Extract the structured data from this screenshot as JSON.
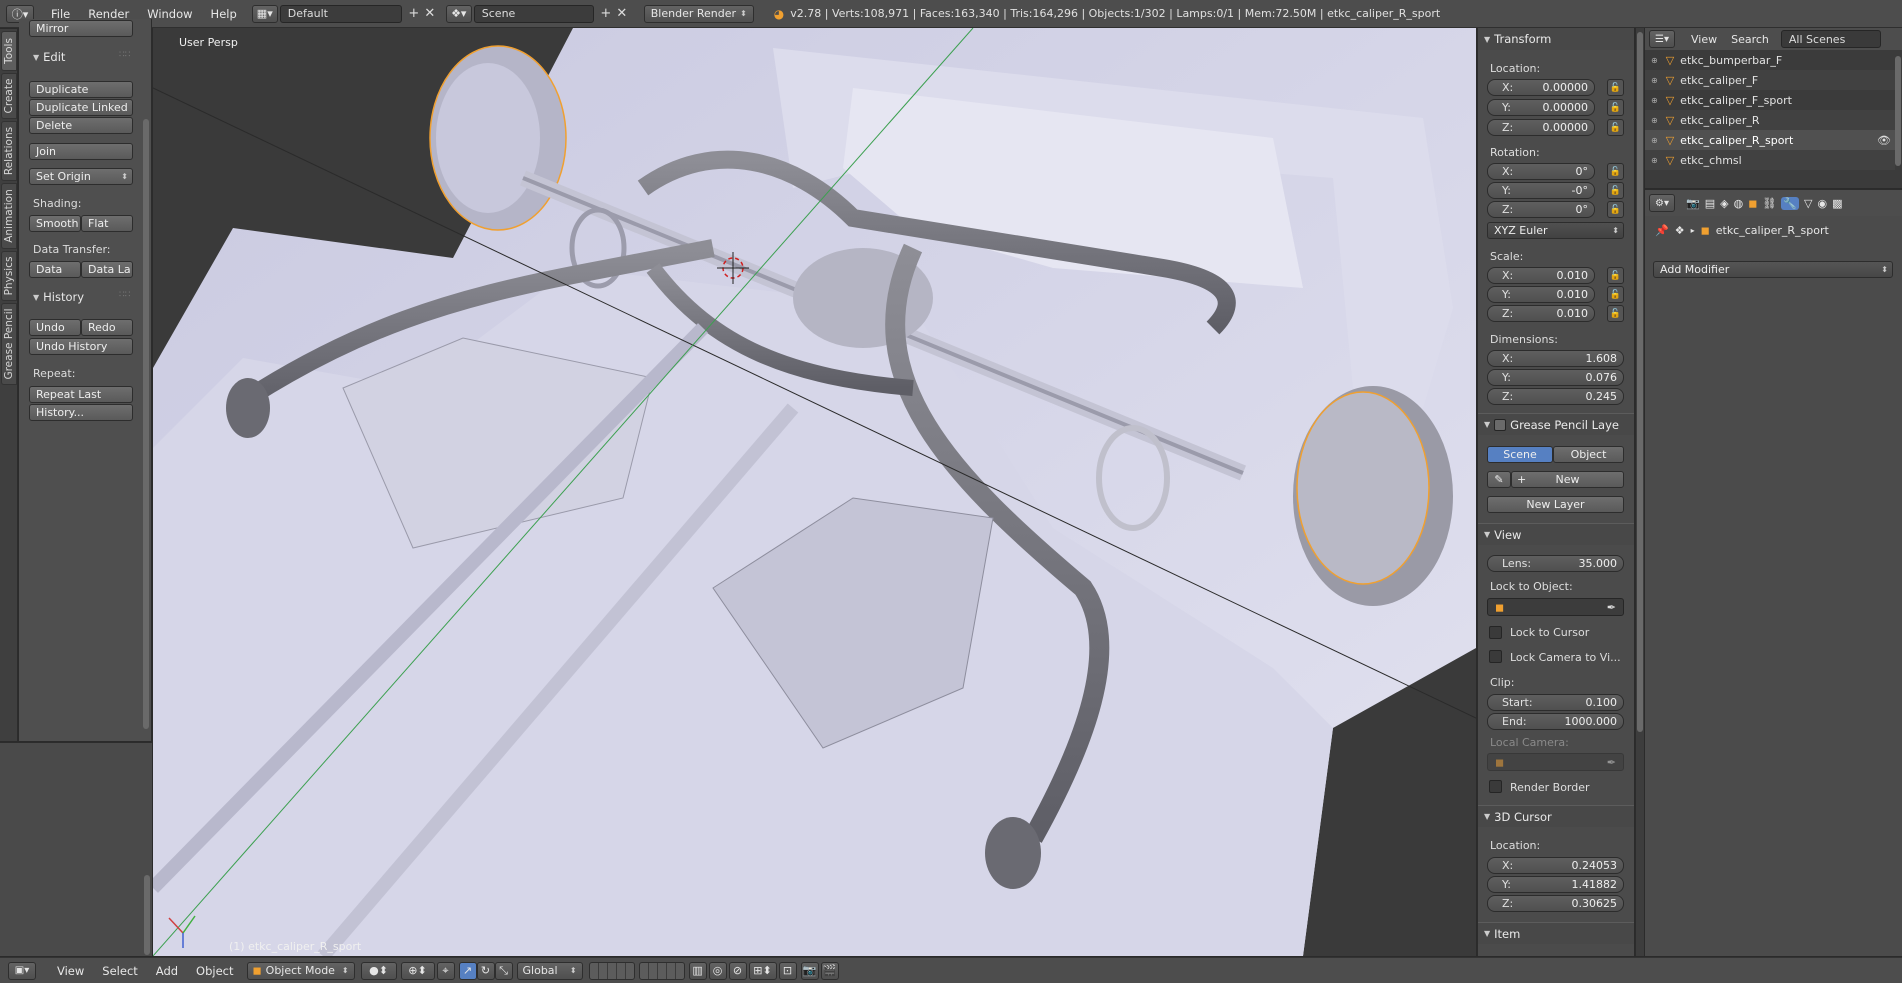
{
  "header": {
    "menus": [
      "File",
      "Render",
      "Window",
      "Help"
    ],
    "layout": "Default",
    "scene": "Scene",
    "engine": "Blender Render",
    "stats": "v2.78 | Verts:108,971 | Faces:163,340 | Tris:164,296 | Objects:1/302 | Lamps:0/1 | Mem:72.50M | etkc_caliper_R_sport"
  },
  "tabs": [
    "Tools",
    "Create",
    "Relations",
    "Animation",
    "Physics",
    "Grease Pencil"
  ],
  "toolshelf": {
    "mirror_button": "Mirror",
    "edit_title": "Edit",
    "duplicate": "Duplicate",
    "duplicate_linked": "Duplicate Linked",
    "delete": "Delete",
    "join": "Join",
    "set_origin": "Set Origin",
    "shading_label": "Shading:",
    "smooth": "Smooth",
    "flat": "Flat",
    "data_transfer_label": "Data Transfer:",
    "data": "Data",
    "data_layout": "Data La",
    "history_title": "History",
    "undo": "Undo",
    "redo": "Redo",
    "undo_history": "Undo History",
    "repeat_label": "Repeat:",
    "repeat_last": "Repeat Last",
    "history_menu": "History..."
  },
  "viewport": {
    "view_name": "User Persp",
    "object_label": "(1) etkc_caliper_R_sport"
  },
  "npanel": {
    "transform_title": "Transform",
    "location_label": "Location:",
    "location": {
      "x": "0.00000",
      "y": "0.00000",
      "z": "0.00000"
    },
    "rotation_label": "Rotation:",
    "rotation": {
      "x": "0°",
      "y": "-0°",
      "z": "0°"
    },
    "rotation_mode": "XYZ Euler",
    "scale_label": "Scale:",
    "scale": {
      "x": "0.010",
      "y": "0.010",
      "z": "0.010"
    },
    "dimensions_label": "Dimensions:",
    "dimensions": {
      "x": "1.608",
      "y": "0.076",
      "z": "0.245"
    },
    "grease_title": "Grease Pencil Laye",
    "gp_scene": "Scene",
    "gp_object": "Object",
    "gp_new": "New",
    "gp_new_layer": "New Layer",
    "view_title": "View",
    "lens_label": "Lens:",
    "lens": "35.000",
    "lock_object_label": "Lock to Object:",
    "lock_cursor": "Lock to Cursor",
    "lock_camera": "Lock Camera to Vi...",
    "clip_label": "Clip:",
    "clip_start_label": "Start:",
    "clip_start": "0.100",
    "clip_end_label": "End:",
    "clip_end": "1000.000",
    "local_camera_label": "Local Camera:",
    "render_border": "Render Border",
    "cursor_title": "3D Cursor",
    "cursor_location_label": "Location:",
    "cursor": {
      "x": "0.24053",
      "y": "1.41882",
      "z": "0.30625"
    },
    "item_title": "Item",
    "axis_x": "X:",
    "axis_y": "Y:",
    "axis_z": "Z:"
  },
  "outliner": {
    "view": "View",
    "search": "Search",
    "filter": "All Scenes",
    "items": [
      "etkc_bumperbar_F",
      "etkc_caliper_F",
      "etkc_caliper_F_sport",
      "etkc_caliper_R",
      "etkc_caliper_R_sport",
      "etkc_chmsl"
    ]
  },
  "properties": {
    "object_name": "etkc_caliper_R_sport",
    "add_modifier": "Add Modifier"
  },
  "bottombar": {
    "menus": [
      "View",
      "Select",
      "Add",
      "Object"
    ],
    "mode": "Object Mode",
    "orientation": "Global"
  },
  "colors": {
    "accent_blue": "#5680c2",
    "selection_orange": "#f0a030",
    "panel_bg": "#4b4b4b"
  }
}
